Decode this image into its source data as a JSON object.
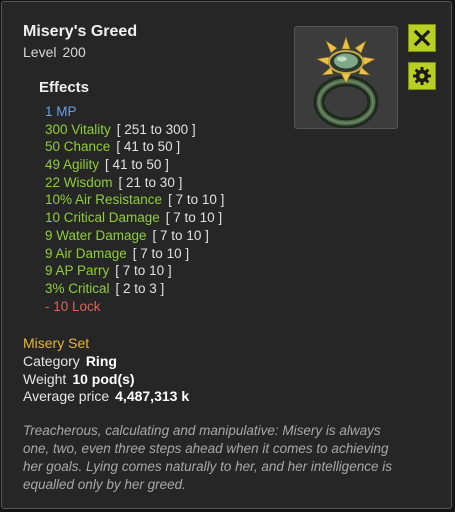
{
  "item": {
    "name": "Misery's Greed",
    "level_label": "Level",
    "level": "200"
  },
  "effects_title": "Effects",
  "effects": [
    {
      "text": "1 MP",
      "range": "",
      "color": "#6a9fe4"
    },
    {
      "text": "300 Vitality",
      "range": "[ 251 to 300 ]",
      "color": "#8fce3a"
    },
    {
      "text": "50 Chance",
      "range": "[ 41 to 50 ]",
      "color": "#8fce3a"
    },
    {
      "text": "49 Agility",
      "range": "[ 41 to 50 ]",
      "color": "#8fce3a"
    },
    {
      "text": "22 Wisdom",
      "range": "[ 21 to 30 ]",
      "color": "#8fce3a"
    },
    {
      "text": "10% Air Resistance",
      "range": "[ 7 to 10 ]",
      "color": "#8fce3a"
    },
    {
      "text": "10 Critical Damage",
      "range": "[ 7 to 10 ]",
      "color": "#8fce3a"
    },
    {
      "text": "9 Water Damage",
      "range": "[ 7 to 10 ]",
      "color": "#8fce3a"
    },
    {
      "text": "9 Air Damage",
      "range": "[ 7 to 10 ]",
      "color": "#8fce3a"
    },
    {
      "text": "9 AP Parry",
      "range": "[ 7 to 10 ]",
      "color": "#8fce3a"
    },
    {
      "text": "3% Critical",
      "range": "[ 2 to 3 ]",
      "color": "#8fce3a"
    },
    {
      "text": "- 10 Lock",
      "range": "",
      "color": "#e0605a"
    }
  ],
  "set_name": "Misery Set",
  "properties": {
    "category_label": "Category",
    "category": "Ring",
    "weight_label": "Weight",
    "weight": "10 pod(s)",
    "price_label": "Average price",
    "price": "4,487,313 k"
  },
  "description": "Treacherous, calculating and manipulative: Misery is always one, two, even three steps ahead when it comes to achieving her goals. Lying comes naturally to her, and her intelligence is equalled only by her greed.",
  "icons": {
    "close": "close-icon",
    "settings": "gear-icon",
    "item": "spiked-ring-icon"
  },
  "colors": {
    "accent": "#b8cf24",
    "set": "#e8b634",
    "positive": "#8fce3a",
    "negative": "#e0605a",
    "mp": "#6a9fe4"
  }
}
